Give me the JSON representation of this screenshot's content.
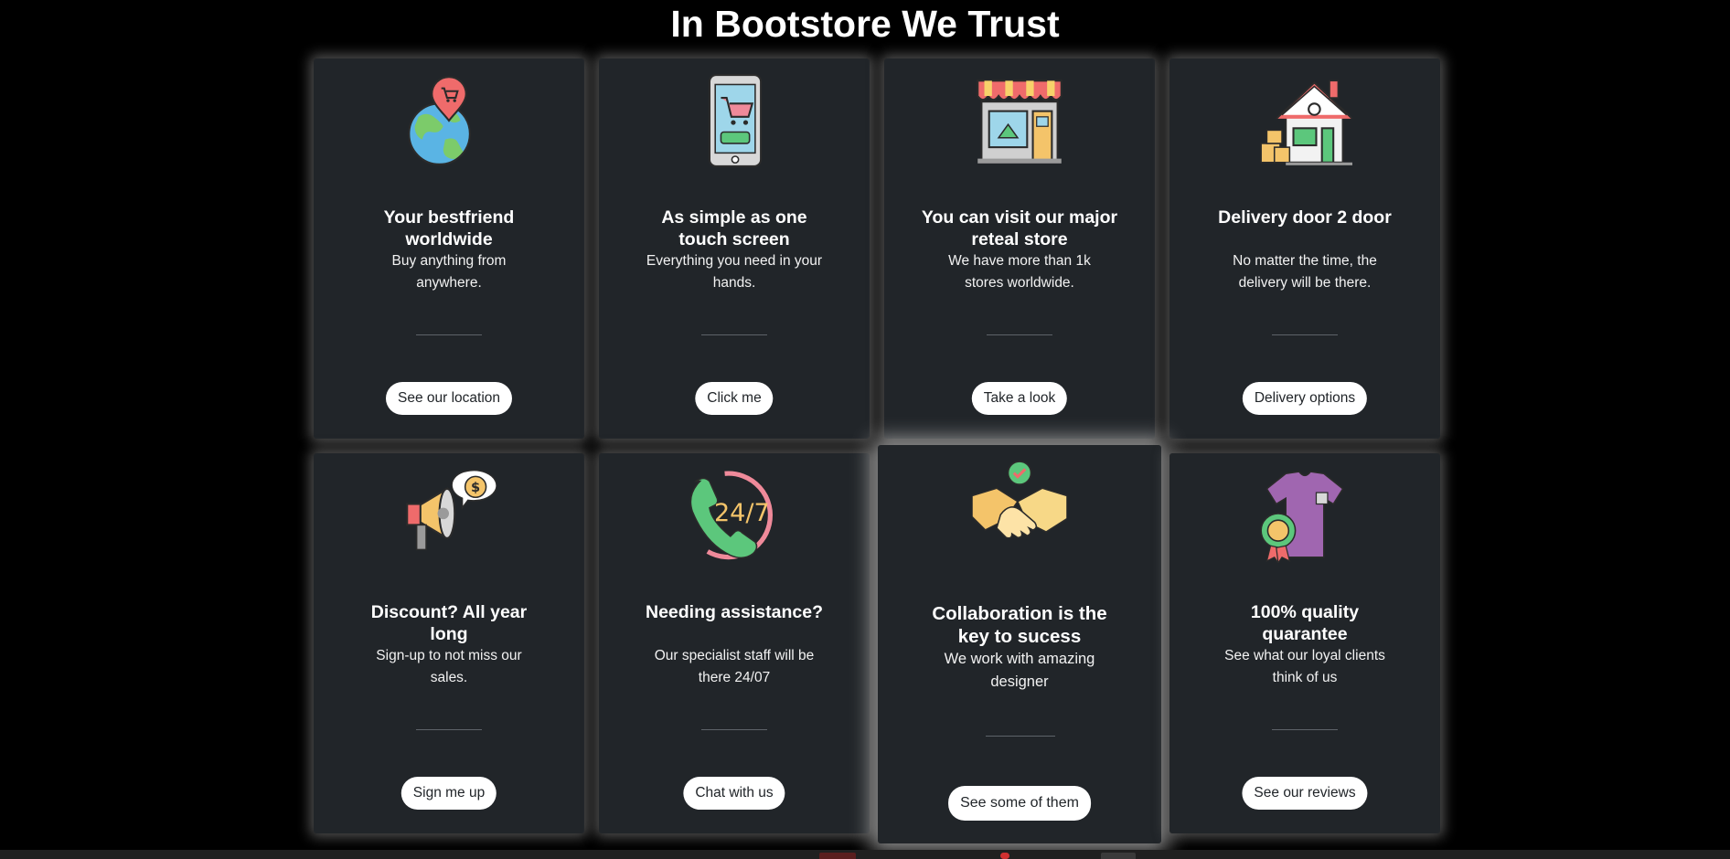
{
  "page": {
    "title": "In Bootstore We Trust"
  },
  "cards": [
    {
      "title": "Your bestfriend worldwide",
      "text": "Buy anything from anywhere.",
      "button": "See our location",
      "icon": "globe-cart-icon"
    },
    {
      "title": "As simple as one touch screen",
      "text": "Everything you need in your hands.",
      "button": "Click me",
      "icon": "phone-cart-icon"
    },
    {
      "title": "You can visit our major reteal store",
      "text": "We have more than 1k stores worldwide.",
      "button": "Take a look",
      "icon": "storefront-icon"
    },
    {
      "title": "Delivery door 2 door",
      "text": "No matter the time, the delivery will be there.",
      "button": "Delivery options",
      "icon": "house-boxes-icon"
    },
    {
      "title": "Discount? All year long",
      "text": "Sign-up to not miss our sales.",
      "button": "Sign me up",
      "icon": "megaphone-dollar-icon"
    },
    {
      "title": "Needing assistance?",
      "text": "Our specialist staff will be there 24/07",
      "button": "Chat with us",
      "icon": "phone-24-7-icon"
    },
    {
      "title": "Collaboration is the key to sucess",
      "text": "We work with amazing designer",
      "button": "See some of them",
      "icon": "handshake-check-icon"
    },
    {
      "title": "100% quality quarantee",
      "text": "See what our loyal clients think of us",
      "button": "See our reviews",
      "icon": "shirt-badge-icon"
    }
  ],
  "icon_text": {
    "hours": "24/7",
    "currency": "$"
  },
  "colors": {
    "background": "#000000",
    "card": "#212529",
    "button_bg": "#ffffff",
    "button_text": "#212529"
  }
}
